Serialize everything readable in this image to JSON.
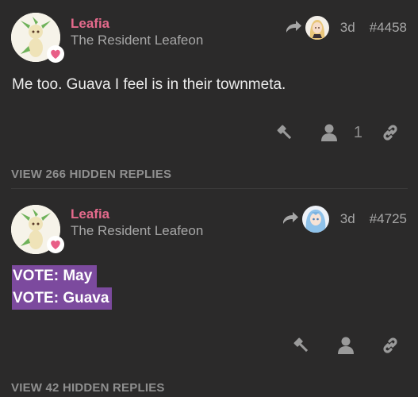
{
  "posts": [
    {
      "username": "Leafia",
      "user_title": "The Resident Leafeon",
      "reply_to_avatar": "reply-avatar-blonde",
      "age": "3d",
      "post_number": "#4458",
      "body": "Me too. Guava I feel is in their townmeta.",
      "like_count": "1",
      "hidden_replies": "VIEW 266 HIDDEN REPLIES"
    },
    {
      "username": "Leafia",
      "user_title": "The Resident Leafeon",
      "reply_to_avatar": "reply-avatar-bluehair",
      "age": "3d",
      "post_number": "#4725",
      "votes": [
        "VOTE: May",
        "VOTE: Guava"
      ],
      "hidden_replies": "VIEW 42 HIDDEN REPLIES"
    }
  ],
  "icons": {
    "reply": "reply-arrow-icon",
    "gavel": "gavel-icon",
    "user": "user-icon",
    "link": "link-icon",
    "heart": "heart-badge-icon"
  },
  "colors": {
    "background": "#2b2a2a",
    "username": "#e46a8c",
    "muted": "#a7a7a7",
    "vote_highlight": "#7c4a9e"
  }
}
